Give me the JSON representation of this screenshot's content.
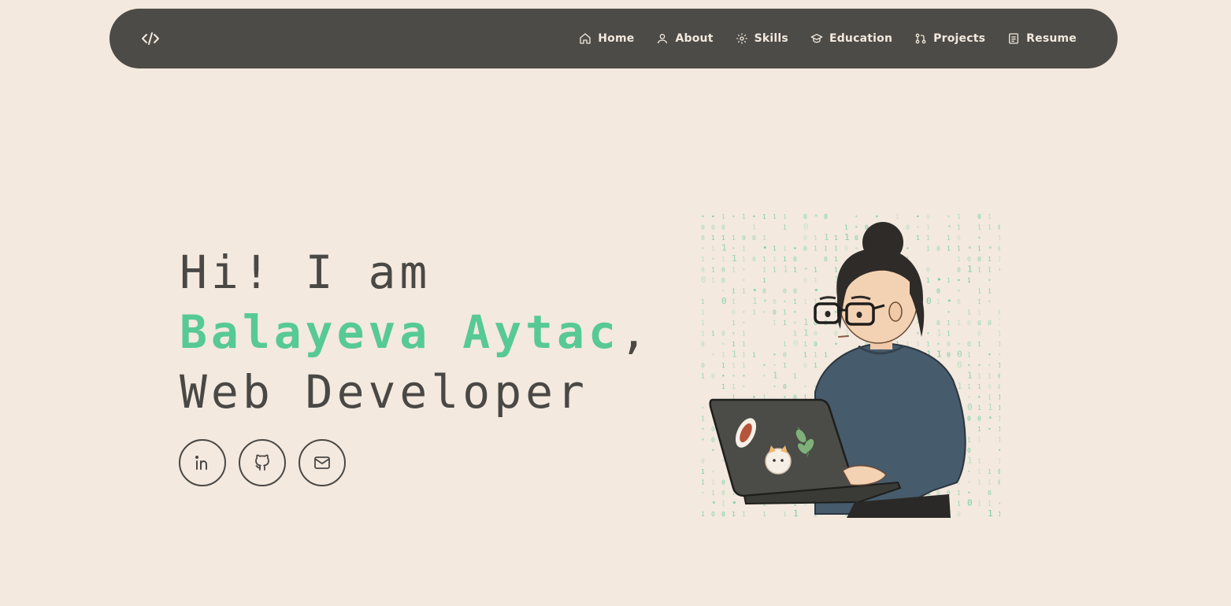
{
  "nav": {
    "logo_icon": "code-icon",
    "items": [
      {
        "label": "Home",
        "icon": "home-icon"
      },
      {
        "label": "About",
        "icon": "user-icon"
      },
      {
        "label": "Skills",
        "icon": "gear-icon"
      },
      {
        "label": "Education",
        "icon": "graduation-cap-icon"
      },
      {
        "label": "Projects",
        "icon": "projects-icon"
      },
      {
        "label": "Resume",
        "icon": "document-icon"
      }
    ]
  },
  "hero": {
    "greeting": "Hi! I am",
    "name": "Balayeva Aytac",
    "name_suffix": ",",
    "role": "Web Developer"
  },
  "socials": [
    {
      "icon": "linkedin-icon"
    },
    {
      "icon": "github-icon"
    },
    {
      "icon": "mail-icon"
    }
  ],
  "colors": {
    "background": "#f3e9de",
    "navbar": "#4d4b47",
    "accent": "#57c994",
    "text": "#4a4845"
  }
}
